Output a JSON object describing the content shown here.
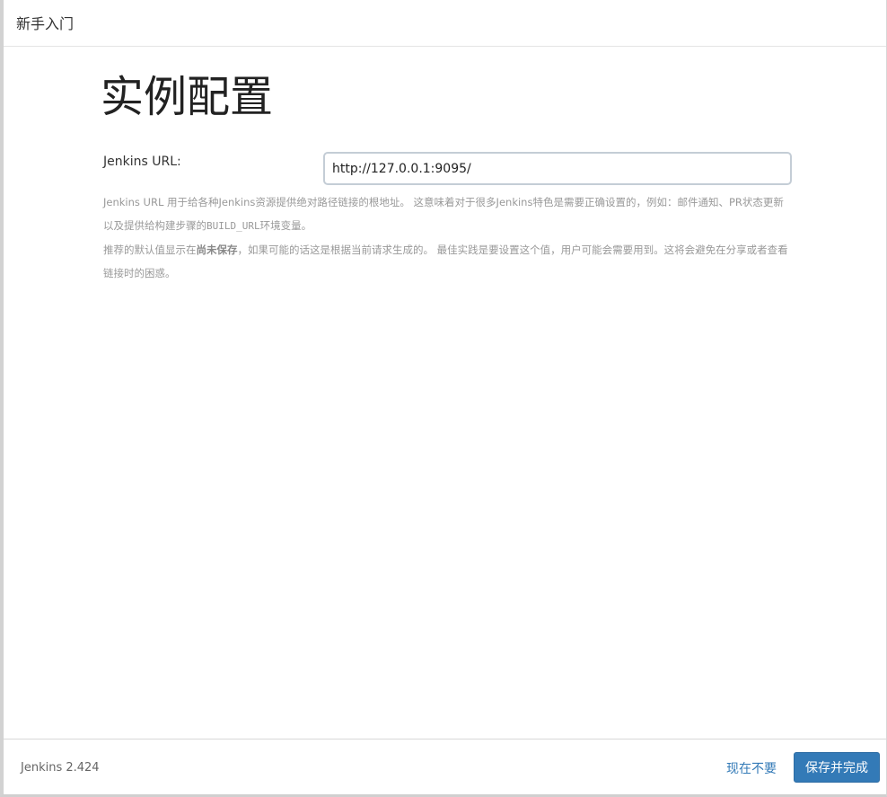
{
  "header": {
    "title": "新手入门"
  },
  "main": {
    "page_title": "实例配置",
    "url_field": {
      "label": "Jenkins URL:",
      "value": "http://127.0.0.1:9095/"
    },
    "help": {
      "p1_text": "Jenkins URL 用于给各种Jenkins资源提供绝对路径链接的根地址。 这意味着对于很多Jenkins特色是需要正确设置的，例如：邮件通知、PR状态更新以及提供给构建步骤的",
      "p1_code": "BUILD_URL",
      "p1_suffix": "环境变量。",
      "p2_prefix": "推荐的默认值显示在",
      "p2_bold": "尚未保存",
      "p2_suffix": "，如果可能的话这是根据当前请求生成的。 最佳实践是要设置这个值，用户可能会需要用到。这将会避免在分享或者查看链接时的困惑。"
    }
  },
  "footer": {
    "version": "Jenkins 2.424",
    "skip_label": "现在不要",
    "save_label": "保存并完成"
  }
}
